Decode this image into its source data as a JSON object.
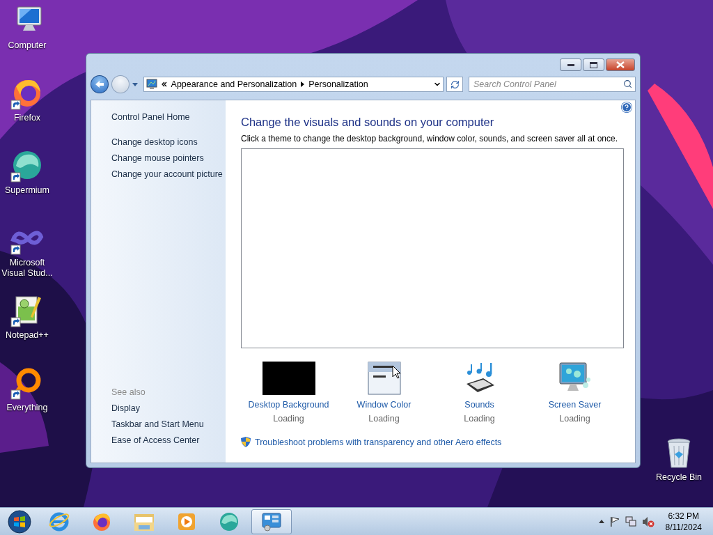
{
  "desktop_icons": [
    {
      "label": "Computer",
      "kind": "computer",
      "shortcut": false
    },
    {
      "label": "Firefox",
      "kind": "firefox",
      "shortcut": true
    },
    {
      "label": "Supermium",
      "kind": "supermium",
      "shortcut": true
    },
    {
      "label": "Microsoft Visual Stud...",
      "kind": "vs",
      "shortcut": true
    },
    {
      "label": "Notepad++",
      "kind": "notepad",
      "shortcut": true
    },
    {
      "label": "Everything",
      "kind": "everything",
      "shortcut": true
    }
  ],
  "recycle_bin": {
    "label": "Recycle Bin"
  },
  "window": {
    "breadcrumb": [
      "Appearance and Personalization",
      "Personalization"
    ],
    "search": {
      "placeholder": "Search Control Panel"
    },
    "sidebar": {
      "home": "Control Panel Home",
      "links": [
        "Change desktop icons",
        "Change mouse pointers",
        "Change your account picture"
      ],
      "see_also_heading": "See also",
      "see_also": [
        "Display",
        "Taskbar and Start Menu",
        "Ease of Access Center"
      ]
    },
    "main": {
      "title": "Change the visuals and sounds on your computer",
      "subtitle": "Click a theme to change the desktop background, window color, sounds, and screen saver all at once.",
      "items": [
        {
          "kind": "background",
          "label": "Desktop Background",
          "status": "Loading"
        },
        {
          "kind": "color",
          "label": "Window Color",
          "status": "Loading"
        },
        {
          "kind": "sounds",
          "label": "Sounds",
          "status": "Loading"
        },
        {
          "kind": "screensaver",
          "label": "Screen Saver",
          "status": "Loading"
        }
      ],
      "troubleshoot": "Troubleshoot problems with transparency and other Aero effects"
    }
  },
  "taskbar": {
    "apps": [
      {
        "kind": "ie",
        "selected": false
      },
      {
        "kind": "firefox",
        "selected": false
      },
      {
        "kind": "explorer",
        "selected": false
      },
      {
        "kind": "media",
        "selected": false
      },
      {
        "kind": "supermium",
        "selected": false
      },
      {
        "kind": "controlpanel",
        "selected": true
      }
    ],
    "time": "6:32 PM",
    "date": "8/11/2024"
  }
}
